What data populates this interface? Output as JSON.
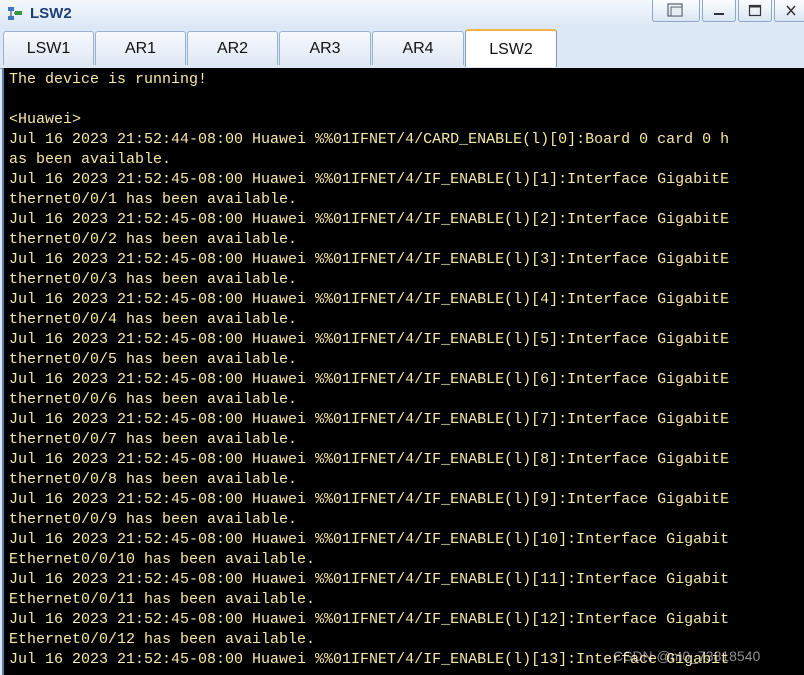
{
  "window": {
    "title": "LSW2",
    "icon": "network-device-icon",
    "buttons": [
      {
        "name": "restore-layout-button",
        "icon": "restore-layout-icon"
      },
      {
        "name": "minimize-button",
        "icon": "minimize-icon"
      },
      {
        "name": "maximize-button",
        "icon": "maximize-icon"
      },
      {
        "name": "close-button",
        "icon": "close-icon"
      }
    ]
  },
  "tabs": [
    {
      "label": "LSW1",
      "active": false
    },
    {
      "label": "AR1",
      "active": false
    },
    {
      "label": "AR2",
      "active": false
    },
    {
      "label": "AR3",
      "active": false
    },
    {
      "label": "AR4",
      "active": false
    },
    {
      "label": "LSW2",
      "active": true
    }
  ],
  "terminal": {
    "text_color": "#f7e8a2",
    "background": "#000000",
    "lines": [
      "The device is running!",
      "",
      "<Huawei>",
      "Jul 16 2023 21:52:44-08:00 Huawei %%01IFNET/4/CARD_ENABLE(l)[0]:Board 0 card 0 h",
      "as been available.",
      "Jul 16 2023 21:52:45-08:00 Huawei %%01IFNET/4/IF_ENABLE(l)[1]:Interface GigabitE",
      "thernet0/0/1 has been available.",
      "Jul 16 2023 21:52:45-08:00 Huawei %%01IFNET/4/IF_ENABLE(l)[2]:Interface GigabitE",
      "thernet0/0/2 has been available.",
      "Jul 16 2023 21:52:45-08:00 Huawei %%01IFNET/4/IF_ENABLE(l)[3]:Interface GigabitE",
      "thernet0/0/3 has been available.",
      "Jul 16 2023 21:52:45-08:00 Huawei %%01IFNET/4/IF_ENABLE(l)[4]:Interface GigabitE",
      "thernet0/0/4 has been available.",
      "Jul 16 2023 21:52:45-08:00 Huawei %%01IFNET/4/IF_ENABLE(l)[5]:Interface GigabitE",
      "thernet0/0/5 has been available.",
      "Jul 16 2023 21:52:45-08:00 Huawei %%01IFNET/4/IF_ENABLE(l)[6]:Interface GigabitE",
      "thernet0/0/6 has been available.",
      "Jul 16 2023 21:52:45-08:00 Huawei %%01IFNET/4/IF_ENABLE(l)[7]:Interface GigabitE",
      "thernet0/0/7 has been available.",
      "Jul 16 2023 21:52:45-08:00 Huawei %%01IFNET/4/IF_ENABLE(l)[8]:Interface GigabitE",
      "thernet0/0/8 has been available.",
      "Jul 16 2023 21:52:45-08:00 Huawei %%01IFNET/4/IF_ENABLE(l)[9]:Interface GigabitE",
      "thernet0/0/9 has been available.",
      "Jul 16 2023 21:52:45-08:00 Huawei %%01IFNET/4/IF_ENABLE(l)[10]:Interface Gigabit",
      "Ethernet0/0/10 has been available.",
      "Jul 16 2023 21:52:45-08:00 Huawei %%01IFNET/4/IF_ENABLE(l)[11]:Interface Gigabit",
      "Ethernet0/0/11 has been available.",
      "Jul 16 2023 21:52:45-08:00 Huawei %%01IFNET/4/IF_ENABLE(l)[12]:Interface Gigabit",
      "Ethernet0/0/12 has been available.",
      "Jul 16 2023 21:52:45-08:00 Huawei %%01IFNET/4/IF_ENABLE(l)[13]:Interface Gigabit"
    ]
  },
  "watermark": "CSDN @m0_73818540"
}
